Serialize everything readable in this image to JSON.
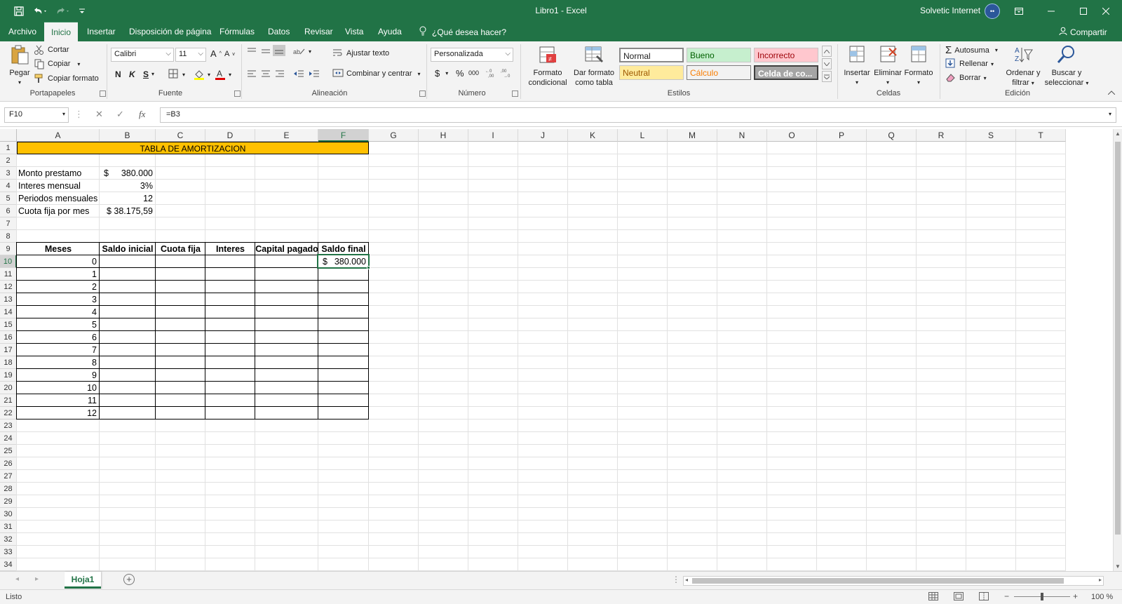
{
  "app": {
    "title": "Libro1  -  Excel",
    "user": "Solvetic Internet",
    "avatar_initials": "••",
    "accent": "#217346"
  },
  "tabs": [
    {
      "label": "Archivo"
    },
    {
      "label": "Inicio"
    },
    {
      "label": "Insertar"
    },
    {
      "label": "Disposición de página"
    },
    {
      "label": "Fórmulas"
    },
    {
      "label": "Datos"
    },
    {
      "label": "Revisar"
    },
    {
      "label": "Vista"
    },
    {
      "label": "Ayuda"
    }
  ],
  "tell_me": "¿Qué desea hacer?",
  "share": "Compartir",
  "ribbon": {
    "clipboard": {
      "paste": "Pegar",
      "cut": "Cortar",
      "copy": "Copiar",
      "format_painter": "Copiar formato",
      "label": "Portapapeles"
    },
    "font": {
      "name": "Calibri",
      "size": "11",
      "bold": "N",
      "italic": "K",
      "underline": "S",
      "label": "Fuente"
    },
    "alignment": {
      "wrap": "Ajustar texto",
      "merge": "Combinar y centrar",
      "label": "Alineación"
    },
    "number": {
      "format": "Personalizada",
      "label": "Número",
      "currency": "$",
      "percent": "%",
      "thousands": "000"
    },
    "styles": {
      "conditional": [
        "Formato",
        "condicional"
      ],
      "as_table": [
        "Dar formato",
        "como tabla"
      ],
      "label": "Estilos",
      "normal": "Normal",
      "good": "Bueno",
      "bad": "Incorrecto",
      "neutral": "Neutral",
      "calc": "Cálculo",
      "check": "Celda de co..."
    },
    "cells": {
      "insert": "Insertar",
      "delete": "Eliminar",
      "format": "Formato",
      "label": "Celdas"
    },
    "editing": {
      "autosum": "Autosuma",
      "fill": "Rellenar",
      "clear": "Borrar",
      "sort": [
        "Ordenar y",
        "filtrar"
      ],
      "find": [
        "Buscar y",
        "seleccionar"
      ],
      "label": "Edición"
    }
  },
  "formula_bar": {
    "name_box": "F10",
    "formula": "=B3"
  },
  "sheet": {
    "columns": [
      "A",
      "B",
      "C",
      "D",
      "E",
      "F",
      "G",
      "H",
      "I",
      "J",
      "K",
      "L",
      "M",
      "N",
      "O",
      "P",
      "Q",
      "R",
      "S",
      "T"
    ],
    "rows": [
      "1",
      "2",
      "3",
      "4",
      "5",
      "6",
      "7",
      "8",
      "9",
      "10",
      "11",
      "12",
      "13",
      "14",
      "15",
      "16",
      "17",
      "18",
      "19",
      "20",
      "21",
      "22",
      "23",
      "24",
      "25",
      "26",
      "27",
      "28",
      "29",
      "30",
      "31",
      "32",
      "33",
      "34"
    ],
    "title": "TABLA DE AMORTIZACION",
    "params": [
      {
        "label": "Monto prestamo",
        "prefix": "$",
        "value": "380.000"
      },
      {
        "label": "Interes mensual",
        "prefix": "",
        "value": "3%"
      },
      {
        "label": "Periodos mensuales",
        "prefix": "",
        "value": "12"
      },
      {
        "label": "Cuota fija por mes",
        "prefix": "",
        "value": "$ 38.175,59"
      }
    ],
    "table_headers": [
      "Meses",
      "Saldo inicial",
      "Cuota fija",
      "Interes",
      "Capital pagado",
      "Saldo final"
    ],
    "months": [
      "0",
      "1",
      "2",
      "3",
      "4",
      "5",
      "6",
      "7",
      "8",
      "9",
      "10",
      "11",
      "12"
    ],
    "saldo_final_first": {
      "prefix": "$",
      "value": "380.000"
    },
    "title_fill": "#ffc000"
  },
  "sheet_tab": "Hoja1",
  "status": {
    "ready": "Listo",
    "zoom": "100 %"
  }
}
